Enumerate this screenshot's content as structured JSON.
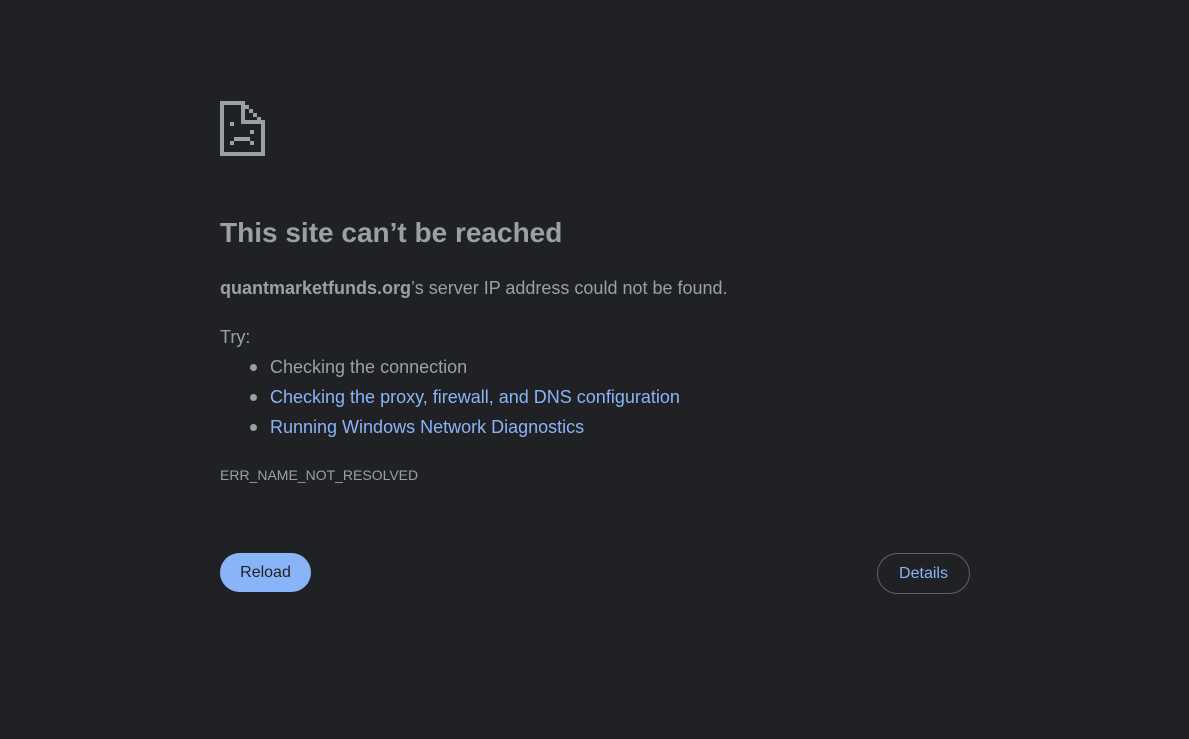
{
  "page": {
    "background": "#202124",
    "text_color": "#9aa0a6",
    "link_color": "#8ab4f8"
  },
  "icon": {
    "name": "sad-page-icon",
    "color": "#9aa0a6"
  },
  "error": {
    "title": "This site can’t be reached",
    "domain": "quantmarketfunds.org",
    "summary_suffix": "’s server IP address could not be found.",
    "try_label": "Try:",
    "suggestions": [
      {
        "text": "Checking the connection",
        "is_link": false
      },
      {
        "text": "Checking the proxy, firewall, and DNS configuration",
        "is_link": true
      },
      {
        "text": "Running Windows Network Diagnostics",
        "is_link": true
      }
    ],
    "code": "ERR_NAME_NOT_RESOLVED"
  },
  "buttons": {
    "reload_label": "Reload",
    "details_label": "Details"
  }
}
